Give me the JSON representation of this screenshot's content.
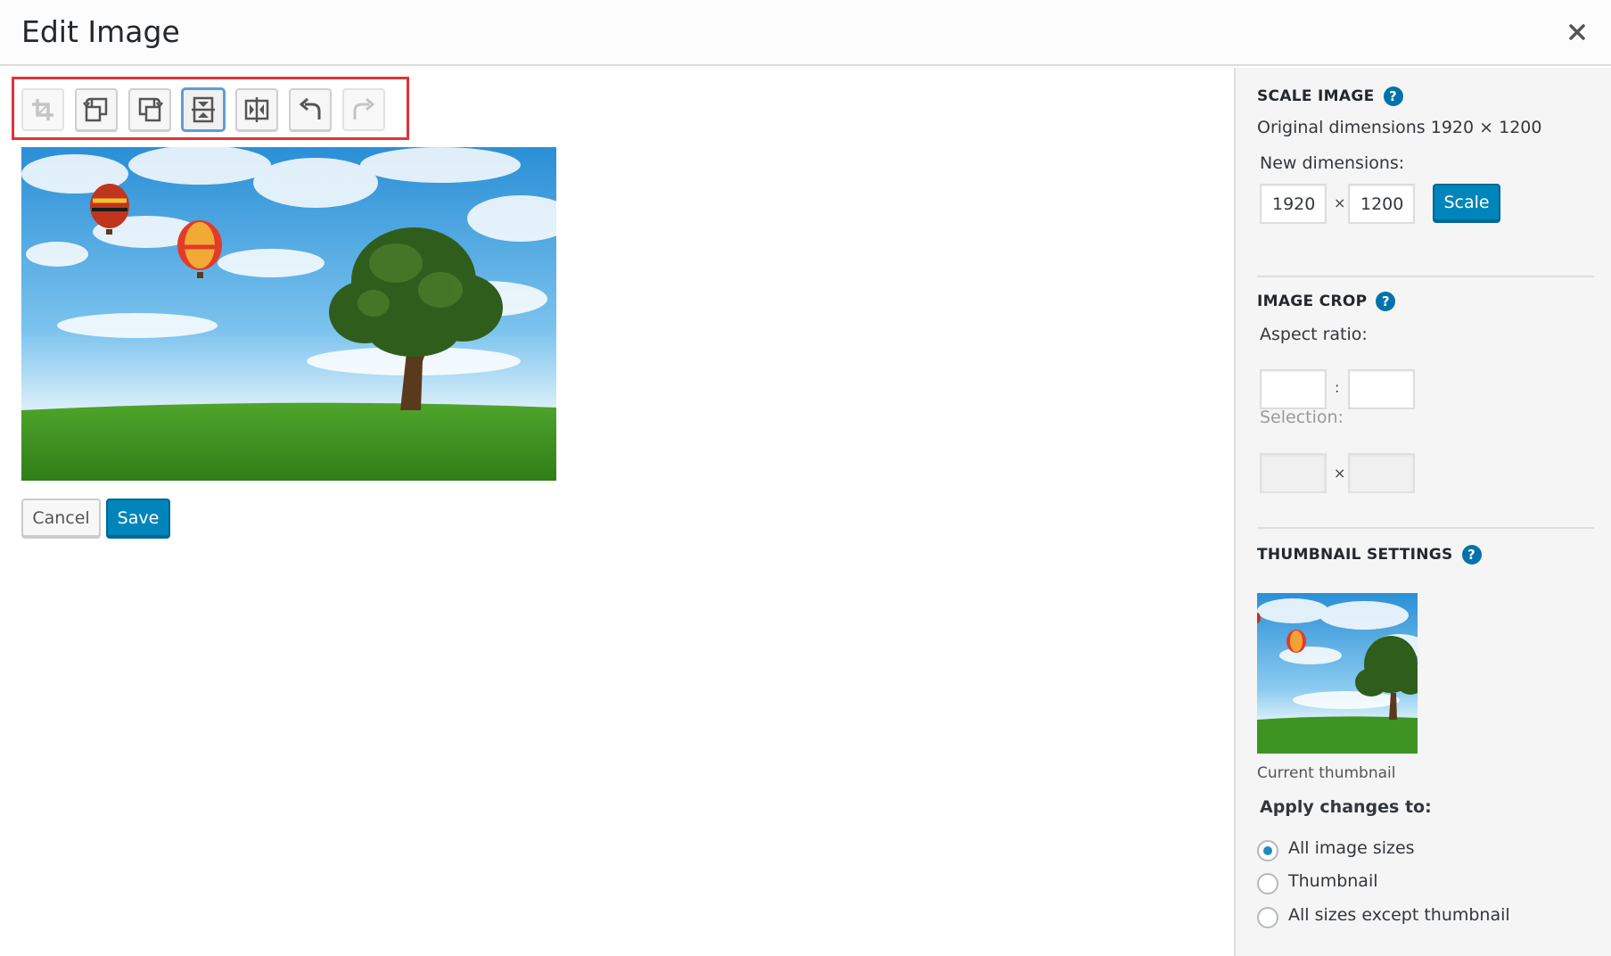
{
  "header": {
    "title": "Edit Image"
  },
  "toolbar": {
    "tools": [
      {
        "name": "crop",
        "state": "disabled"
      },
      {
        "name": "rotate-left",
        "state": "normal"
      },
      {
        "name": "rotate-right",
        "state": "normal"
      },
      {
        "name": "flip-vertical",
        "state": "active"
      },
      {
        "name": "flip-horizontal",
        "state": "normal"
      },
      {
        "name": "undo",
        "state": "normal"
      },
      {
        "name": "redo",
        "state": "disabled"
      }
    ]
  },
  "actions": {
    "cancel_label": "Cancel",
    "save_label": "Save"
  },
  "scale": {
    "title": "SCALE IMAGE",
    "original_label": "Original dimensions 1920 × 1200",
    "new_label": "New dimensions:",
    "width": "1920",
    "height": "1200",
    "separator": "×",
    "button_label": "Scale"
  },
  "crop": {
    "title": "IMAGE CROP",
    "aspect_label": "Aspect ratio:",
    "aspect_separator": ":",
    "aspect_w": "",
    "aspect_h": "",
    "selection_label": "Selection:",
    "selection_separator": "×",
    "selection_w": "",
    "selection_h": ""
  },
  "thumbnail": {
    "title": "THUMBNAIL SETTINGS",
    "caption": "Current thumbnail",
    "apply_label": "Apply changes to:",
    "options": [
      {
        "label": "All image sizes",
        "checked": true
      },
      {
        "label": "Thumbnail",
        "checked": false
      },
      {
        "label": "All sizes except thumbnail",
        "checked": false
      }
    ]
  },
  "colors": {
    "primary": "#0085ba",
    "help": "#0073aa",
    "highlight_box": "#e0333a"
  }
}
